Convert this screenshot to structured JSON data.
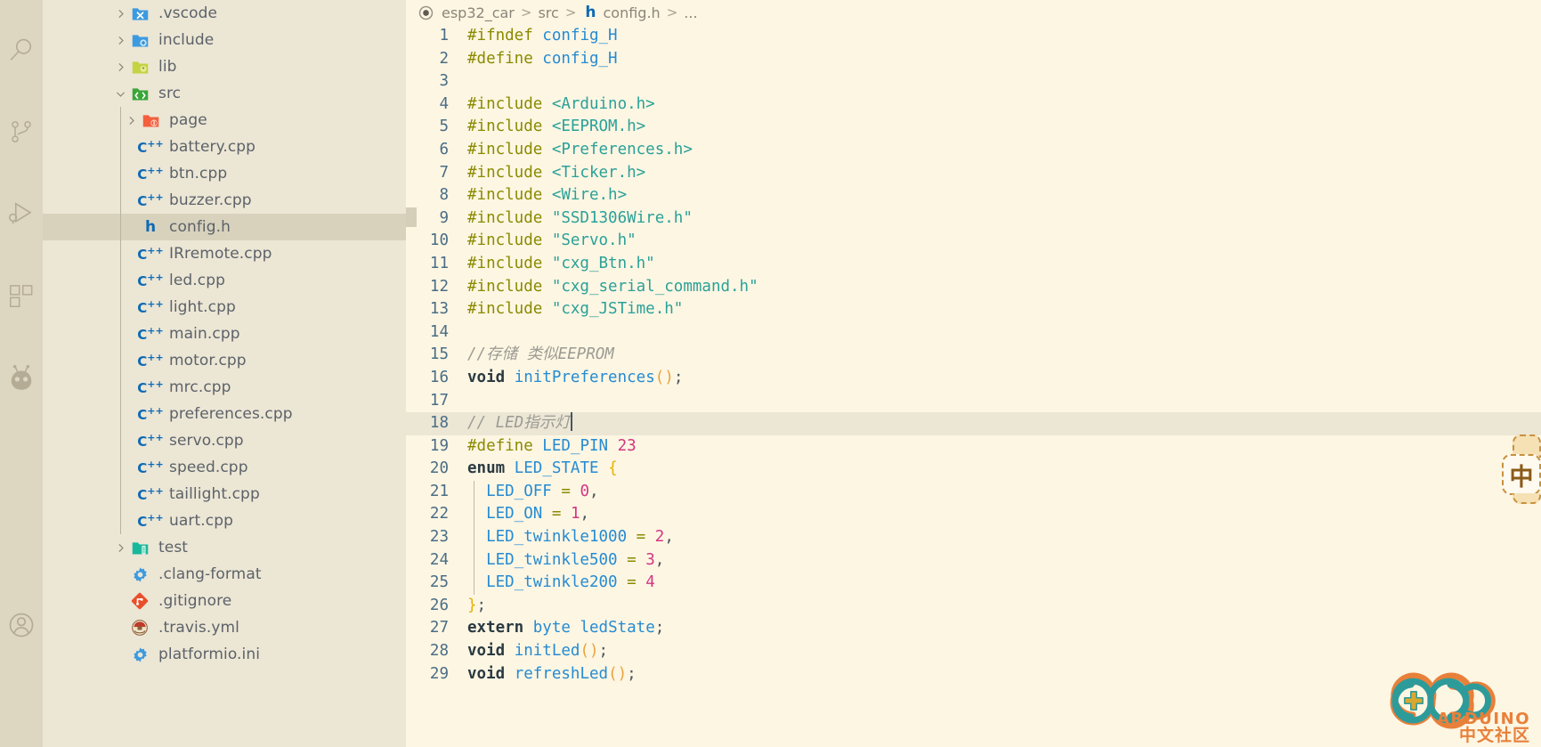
{
  "app": {
    "theme_editor_bg": "#fdf6e3",
    "theme_sidebar_bg": "#ece6d5",
    "theme_activitybar_bg": "#ddd6c1",
    "accent": "#268bd2"
  },
  "activity_bar": {
    "items": [
      {
        "name": "search",
        "icon": "search-icon",
        "title": "Search"
      },
      {
        "name": "source-control",
        "icon": "source-control-icon",
        "title": "Source Control"
      },
      {
        "name": "run-debug",
        "icon": "run-and-debug-icon",
        "title": "Run and Debug"
      },
      {
        "name": "extensions",
        "icon": "extensions-icon",
        "title": "Extensions"
      },
      {
        "name": "platformio",
        "icon": "platformio-ant-icon",
        "title": "PlatformIO"
      },
      {
        "name": "account",
        "icon": "account-icon",
        "title": "Accounts"
      }
    ]
  },
  "explorer": {
    "tree": [
      {
        "label": ".vscode",
        "depth": 0,
        "kind": "folder",
        "icon": "vscode-folder-icon",
        "expanded": false,
        "arrow": "right",
        "selected": false
      },
      {
        "label": "include",
        "depth": 0,
        "kind": "folder",
        "icon": "include-folder-icon",
        "expanded": false,
        "arrow": "right",
        "selected": false
      },
      {
        "label": "lib",
        "depth": 0,
        "kind": "folder",
        "icon": "lib-folder-icon",
        "expanded": false,
        "arrow": "right",
        "selected": false
      },
      {
        "label": "src",
        "depth": 0,
        "kind": "folder",
        "icon": "src-folder-icon",
        "expanded": true,
        "arrow": "down",
        "selected": false
      },
      {
        "label": "page",
        "depth": 1,
        "kind": "folder",
        "icon": "page-folder-icon",
        "expanded": false,
        "arrow": "right",
        "selected": false
      },
      {
        "label": "battery.cpp",
        "depth": 1,
        "kind": "cpp",
        "icon": "cpp-file-icon",
        "selected": false
      },
      {
        "label": "btn.cpp",
        "depth": 1,
        "kind": "cpp",
        "icon": "cpp-file-icon",
        "selected": false
      },
      {
        "label": "buzzer.cpp",
        "depth": 1,
        "kind": "cpp",
        "icon": "cpp-file-icon",
        "selected": false
      },
      {
        "label": "config.h",
        "depth": 1,
        "kind": "header",
        "icon": "h-file-icon",
        "selected": true
      },
      {
        "label": "IRremote.cpp",
        "depth": 1,
        "kind": "cpp",
        "icon": "cpp-file-icon",
        "selected": false
      },
      {
        "label": "led.cpp",
        "depth": 1,
        "kind": "cpp",
        "icon": "cpp-file-icon",
        "selected": false
      },
      {
        "label": "light.cpp",
        "depth": 1,
        "kind": "cpp",
        "icon": "cpp-file-icon",
        "selected": false
      },
      {
        "label": "main.cpp",
        "depth": 1,
        "kind": "cpp",
        "icon": "cpp-file-icon",
        "selected": false
      },
      {
        "label": "motor.cpp",
        "depth": 1,
        "kind": "cpp",
        "icon": "cpp-file-icon",
        "selected": false
      },
      {
        "label": "mrc.cpp",
        "depth": 1,
        "kind": "cpp",
        "icon": "cpp-file-icon",
        "selected": false
      },
      {
        "label": "preferences.cpp",
        "depth": 1,
        "kind": "cpp",
        "icon": "cpp-file-icon",
        "selected": false
      },
      {
        "label": "servo.cpp",
        "depth": 1,
        "kind": "cpp",
        "icon": "cpp-file-icon",
        "selected": false
      },
      {
        "label": "speed.cpp",
        "depth": 1,
        "kind": "cpp",
        "icon": "cpp-file-icon",
        "selected": false
      },
      {
        "label": "taillight.cpp",
        "depth": 1,
        "kind": "cpp",
        "icon": "cpp-file-icon",
        "selected": false
      },
      {
        "label": "uart.cpp",
        "depth": 1,
        "kind": "cpp",
        "icon": "cpp-file-icon",
        "selected": false
      },
      {
        "label": "test",
        "depth": 0,
        "kind": "folder",
        "icon": "test-folder-icon",
        "expanded": false,
        "arrow": "right",
        "selected": false
      },
      {
        "label": ".clang-format",
        "depth": 0,
        "kind": "config",
        "icon": "gear-file-icon",
        "selected": false
      },
      {
        "label": ".gitignore",
        "depth": 0,
        "kind": "git",
        "icon": "git-file-icon",
        "selected": false
      },
      {
        "label": ".travis.yml",
        "depth": 0,
        "kind": "travis",
        "icon": "travis-file-icon",
        "selected": false
      },
      {
        "label": "platformio.ini",
        "depth": 0,
        "kind": "config",
        "icon": "gear-file-icon",
        "selected": false
      }
    ]
  },
  "breadcrumb": {
    "status_icon": "unsaved-circle-icon",
    "items": [
      "esp32_car",
      "src",
      "config.h",
      "..."
    ],
    "file_badge": "h",
    "separator": ">"
  },
  "editor": {
    "active_line": 18,
    "first_line": 1,
    "cursor_line_text": "// LED指示灯",
    "lines": [
      {
        "n": 1,
        "tokens": [
          {
            "t": "#ifndef ",
            "c": "t-pre"
          },
          {
            "t": "config_H",
            "c": "t-mac"
          }
        ]
      },
      {
        "n": 2,
        "tokens": [
          {
            "t": "#define ",
            "c": "t-pre"
          },
          {
            "t": "config_H",
            "c": "t-mac"
          }
        ]
      },
      {
        "n": 3,
        "tokens": []
      },
      {
        "n": 4,
        "tokens": [
          {
            "t": "#include ",
            "c": "t-pre"
          },
          {
            "t": "<Arduino.h>",
            "c": "t-str"
          }
        ]
      },
      {
        "n": 5,
        "tokens": [
          {
            "t": "#include ",
            "c": "t-pre"
          },
          {
            "t": "<EEPROM.h>",
            "c": "t-str"
          }
        ]
      },
      {
        "n": 6,
        "tokens": [
          {
            "t": "#include ",
            "c": "t-pre"
          },
          {
            "t": "<Preferences.h>",
            "c": "t-str"
          }
        ]
      },
      {
        "n": 7,
        "tokens": [
          {
            "t": "#include ",
            "c": "t-pre"
          },
          {
            "t": "<Ticker.h>",
            "c": "t-str"
          }
        ]
      },
      {
        "n": 8,
        "tokens": [
          {
            "t": "#include ",
            "c": "t-pre"
          },
          {
            "t": "<Wire.h>",
            "c": "t-str"
          }
        ]
      },
      {
        "n": 9,
        "tokens": [
          {
            "t": "#include ",
            "c": "t-pre"
          },
          {
            "t": "\"SSD1306Wire.h\"",
            "c": "t-str"
          }
        ]
      },
      {
        "n": 10,
        "tokens": [
          {
            "t": "#include ",
            "c": "t-pre"
          },
          {
            "t": "\"Servo.h\"",
            "c": "t-str"
          }
        ]
      },
      {
        "n": 11,
        "tokens": [
          {
            "t": "#include ",
            "c": "t-pre"
          },
          {
            "t": "\"cxg_Btn.h\"",
            "c": "t-str"
          }
        ]
      },
      {
        "n": 12,
        "tokens": [
          {
            "t": "#include ",
            "c": "t-pre"
          },
          {
            "t": "\"cxg_serial_command.h\"",
            "c": "t-str"
          }
        ]
      },
      {
        "n": 13,
        "tokens": [
          {
            "t": "#include ",
            "c": "t-pre"
          },
          {
            "t": "\"cxg_JSTime.h\"",
            "c": "t-str"
          }
        ]
      },
      {
        "n": 14,
        "tokens": []
      },
      {
        "n": 15,
        "tokens": [
          {
            "t": "//存储 类似EEPROM",
            "c": "t-com"
          }
        ]
      },
      {
        "n": 16,
        "tokens": [
          {
            "t": "void",
            "c": "t-kw"
          },
          {
            "t": " ",
            "c": "t-punct"
          },
          {
            "t": "initPreferences",
            "c": "t-fn"
          },
          {
            "t": "()",
            "c": "t-paren"
          },
          {
            "t": ";",
            "c": "t-punct"
          }
        ]
      },
      {
        "n": 17,
        "tokens": []
      },
      {
        "n": 18,
        "tokens": [
          {
            "t": "// LED指示灯",
            "c": "t-com"
          }
        ],
        "cursor": true,
        "active": true
      },
      {
        "n": 19,
        "tokens": [
          {
            "t": "#define ",
            "c": "t-pre"
          },
          {
            "t": "LED_PIN",
            "c": "t-mac"
          },
          {
            "t": " ",
            "c": "t-punct"
          },
          {
            "t": "23",
            "c": "t-num"
          }
        ]
      },
      {
        "n": 20,
        "tokens": [
          {
            "t": "enum",
            "c": "t-kw"
          },
          {
            "t": " ",
            "c": "t-punct"
          },
          {
            "t": "LED_STATE",
            "c": "t-type"
          },
          {
            "t": " ",
            "c": "t-punct"
          },
          {
            "t": "{",
            "c": "t-brace"
          }
        ]
      },
      {
        "n": 21,
        "tokens": [
          {
            "t": "  ",
            "c": "t-punct"
          },
          {
            "t": "LED_OFF",
            "c": "t-ident"
          },
          {
            "t": " ",
            "c": "t-punct"
          },
          {
            "t": "=",
            "c": "t-op"
          },
          {
            "t": " ",
            "c": "t-punct"
          },
          {
            "t": "0",
            "c": "t-num"
          },
          {
            "t": ",",
            "c": "t-punct"
          }
        ],
        "guide": true
      },
      {
        "n": 22,
        "tokens": [
          {
            "t": "  ",
            "c": "t-punct"
          },
          {
            "t": "LED_ON",
            "c": "t-ident"
          },
          {
            "t": " ",
            "c": "t-punct"
          },
          {
            "t": "=",
            "c": "t-op"
          },
          {
            "t": " ",
            "c": "t-punct"
          },
          {
            "t": "1",
            "c": "t-num"
          },
          {
            "t": ",",
            "c": "t-punct"
          }
        ],
        "guide": true
      },
      {
        "n": 23,
        "tokens": [
          {
            "t": "  ",
            "c": "t-punct"
          },
          {
            "t": "LED_twinkle1000",
            "c": "t-ident"
          },
          {
            "t": " ",
            "c": "t-punct"
          },
          {
            "t": "=",
            "c": "t-op"
          },
          {
            "t": " ",
            "c": "t-punct"
          },
          {
            "t": "2",
            "c": "t-num"
          },
          {
            "t": ",",
            "c": "t-punct"
          }
        ],
        "guide": true
      },
      {
        "n": 24,
        "tokens": [
          {
            "t": "  ",
            "c": "t-punct"
          },
          {
            "t": "LED_twinkle500",
            "c": "t-ident"
          },
          {
            "t": " ",
            "c": "t-punct"
          },
          {
            "t": "=",
            "c": "t-op"
          },
          {
            "t": " ",
            "c": "t-punct"
          },
          {
            "t": "3",
            "c": "t-num"
          },
          {
            "t": ",",
            "c": "t-punct"
          }
        ],
        "guide": true
      },
      {
        "n": 25,
        "tokens": [
          {
            "t": "  ",
            "c": "t-punct"
          },
          {
            "t": "LED_twinkle200",
            "c": "t-ident"
          },
          {
            "t": " ",
            "c": "t-punct"
          },
          {
            "t": "=",
            "c": "t-op"
          },
          {
            "t": " ",
            "c": "t-punct"
          },
          {
            "t": "4",
            "c": "t-num"
          }
        ],
        "guide": true
      },
      {
        "n": 26,
        "tokens": [
          {
            "t": "}",
            "c": "t-brace"
          },
          {
            "t": ";",
            "c": "t-punct"
          }
        ]
      },
      {
        "n": 27,
        "tokens": [
          {
            "t": "extern",
            "c": "t-kw"
          },
          {
            "t": " ",
            "c": "t-punct"
          },
          {
            "t": "byte",
            "c": "t-type"
          },
          {
            "t": " ",
            "c": "t-punct"
          },
          {
            "t": "ledState",
            "c": "t-ident"
          },
          {
            "t": ";",
            "c": "t-punct"
          }
        ]
      },
      {
        "n": 28,
        "tokens": [
          {
            "t": "void",
            "c": "t-kw"
          },
          {
            "t": " ",
            "c": "t-punct"
          },
          {
            "t": "initLed",
            "c": "t-fn"
          },
          {
            "t": "()",
            "c": "t-paren"
          },
          {
            "t": ";",
            "c": "t-punct"
          }
        ]
      },
      {
        "n": 29,
        "tokens": [
          {
            "t": "void",
            "c": "t-kw"
          },
          {
            "t": " ",
            "c": "t-punct"
          },
          {
            "t": "refreshLed",
            "c": "t-fn"
          },
          {
            "t": "()",
            "c": "t-paren"
          },
          {
            "t": ";",
            "c": "t-punct"
          }
        ]
      }
    ]
  },
  "ime_indicator": {
    "label": "中",
    "name": "ime-chinese-mode-indicator"
  },
  "watermark_logo": {
    "brand": "ARDUINO",
    "community": "中文社区",
    "colors": {
      "teal": "#2e9b9b",
      "orange": "#e8803a",
      "yellow": "#e0b020"
    }
  }
}
